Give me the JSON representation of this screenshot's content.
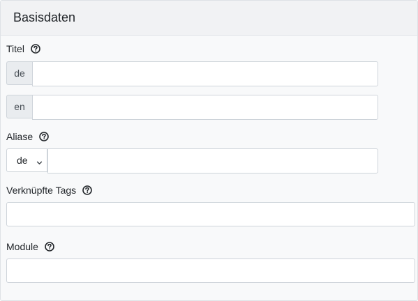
{
  "card": {
    "title": "Basisdaten"
  },
  "fields": {
    "titel": {
      "label": "Titel",
      "languages": [
        "de",
        "en"
      ],
      "values": [
        "",
        ""
      ]
    },
    "aliase": {
      "label": "Aliase",
      "selected_language": "de",
      "value": ""
    },
    "tags": {
      "label": "Verknüpfte Tags",
      "value": ""
    },
    "module": {
      "label": "Module",
      "value": ""
    }
  },
  "icons": {
    "help": "question-circle-icon",
    "select_arrow": "chevron-down-icon"
  },
  "colors": {
    "background": "#f8f9fa",
    "header": "#f1f2f4",
    "border": "#ced4da",
    "addon_bg": "#e9ecef"
  }
}
